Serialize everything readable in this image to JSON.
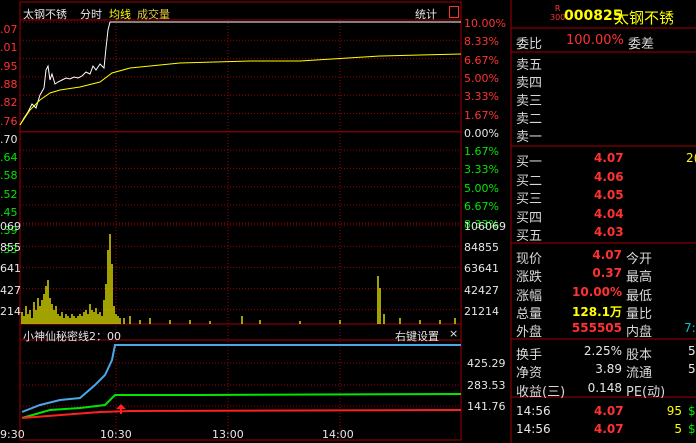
{
  "chart": {
    "stock_name": "太钢不锈",
    "tabs": [
      "分时",
      "均线",
      "成交量"
    ],
    "stats_label": "统计",
    "stats_icon": "box-icon",
    "left_price_ticks": [
      ".07",
      ".01",
      ".95",
      ".88",
      ".82",
      ".76",
      ".70",
      ".64",
      ".58",
      ".52",
      ".45",
      ".39",
      ".33"
    ],
    "right_pct_ticks": [
      "10.00%",
      "8.33%",
      "6.67%",
      "5.00%",
      "3.33%",
      "1.67%",
      "0.00%",
      "1.67%",
      "3.33%",
      "5.00%",
      "6.67%",
      "8.33%"
    ],
    "volume_left_ticks": [
      "069",
      "855",
      "641",
      "427",
      "214"
    ],
    "volume_right_ticks": [
      "106069",
      "84855",
      "63641",
      "42427",
      "21214"
    ],
    "indicator_title": "小神仙秘密线2：00",
    "indicator_settings": "右键设置",
    "indicator_close": "×",
    "indicator_ticks": [
      "425.29",
      "283.53",
      "141.76"
    ],
    "time_ticks": [
      "9:30",
      "10:30",
      "13:00",
      "14:00"
    ],
    "colors": {
      "price": "#ffffff",
      "avg": "#ffff00",
      "volume": "#e6e600",
      "grid": "#a00000",
      "up": "#ff3232",
      "down": "#00e600",
      "line_blue": "#4aa8e8",
      "line_green": "#00e600",
      "line_red": "#ff2020"
    }
  },
  "quote": {
    "badge_top": "R",
    "badge_bottom": "300",
    "code": "000825",
    "name": "太钢不锈",
    "weibi_label": "委比",
    "weibi_value": "100.00%",
    "weicha_label": "委差",
    "sell_labels": [
      "卖五",
      "卖四",
      "卖三",
      "卖二",
      "卖一"
    ],
    "buy": [
      {
        "label": "买一",
        "price": "4.07",
        "vol": "2("
      },
      {
        "label": "买二",
        "price": "4.06",
        "vol": ""
      },
      {
        "label": "买三",
        "price": "4.05",
        "vol": ""
      },
      {
        "label": "买四",
        "price": "4.04",
        "vol": ""
      },
      {
        "label": "买五",
        "price": "4.03",
        "vol": ""
      }
    ],
    "stats": [
      {
        "l1": "现价",
        "v1": "4.07",
        "c1": "red",
        "l2": "今开",
        "v2": ""
      },
      {
        "l1": "涨跌",
        "v1": "0.37",
        "c1": "red",
        "l2": "最高",
        "v2": ""
      },
      {
        "l1": "涨幅",
        "v1": "10.00%",
        "c1": "red",
        "l2": "最低",
        "v2": ""
      },
      {
        "l1": "总量",
        "v1": "128.1万",
        "c1": "yellow",
        "l2": "量比",
        "v2": ""
      },
      {
        "l1": "外盘",
        "v1": "555505",
        "c1": "red",
        "l2": "内盘",
        "v2": "7:"
      }
    ],
    "stats2": [
      {
        "l1": "换手",
        "v1": "2.25%",
        "l2": "股本",
        "v2": "5"
      },
      {
        "l1": "净资",
        "v1": "3.89",
        "l2": "流通",
        "v2": "5"
      },
      {
        "l1": "收益(三)",
        "v1": "0.148",
        "l2": "PE(动)",
        "v2": ""
      }
    ],
    "ticks": [
      {
        "time": "14:56",
        "price": "4.07",
        "vol": "95",
        "flag": "$"
      },
      {
        "time": "14:56",
        "price": "4.07",
        "vol": "5",
        "flag": "$"
      }
    ]
  }
}
